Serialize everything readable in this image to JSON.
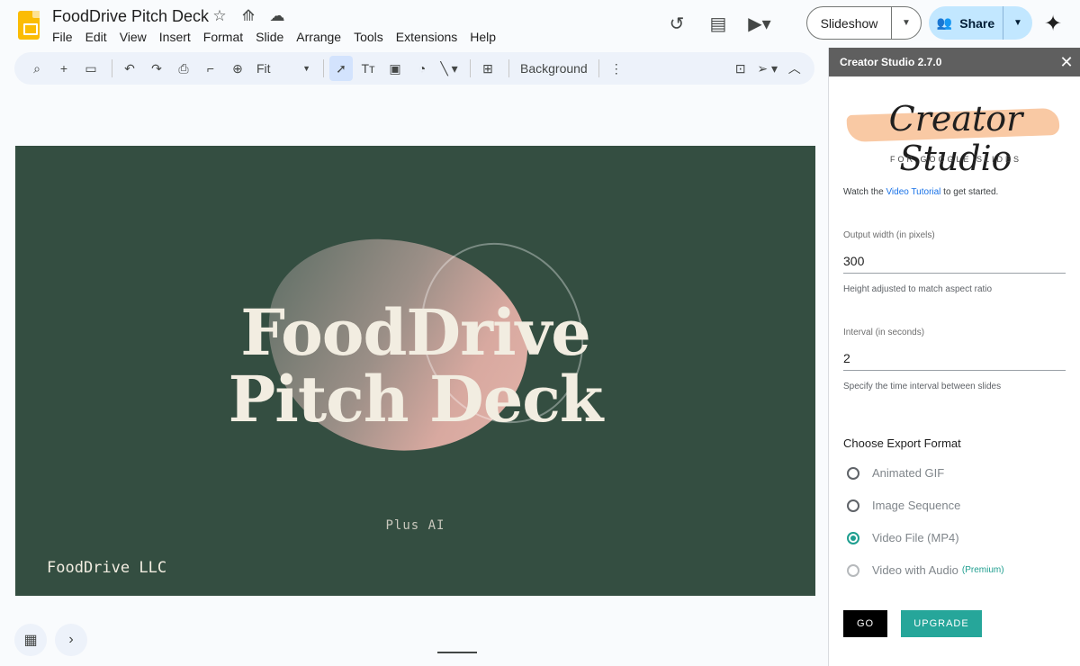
{
  "app": {
    "doc_title": "FoodDrive Pitch Deck",
    "menu": [
      "File",
      "Edit",
      "View",
      "Insert",
      "Format",
      "Slide",
      "Arrange",
      "Tools",
      "Extensions",
      "Help"
    ]
  },
  "header": {
    "slideshow_label": "Slideshow",
    "share_label": "Share"
  },
  "toolbar": {
    "zoom_value": "Fit",
    "background_label": "Background"
  },
  "slide": {
    "title_line1": "FoodDrive",
    "title_line2": "Pitch Deck",
    "subtitle": "Plus AI",
    "company": "FoodDrive LLC",
    "bg_color": "#344e41"
  },
  "panel": {
    "title": "Creator Studio 2.7.0",
    "logo_name": "Creator Studio",
    "logo_for": "FOR GOOGLE SLIDES",
    "intro_prefix": "Watch the ",
    "intro_link": "Video Tutorial",
    "intro_suffix": " to get started.",
    "width_label": "Output width (in pixels)",
    "width_value": "300",
    "width_hint": "Height adjusted to match aspect ratio",
    "interval_label": "Interval (in seconds)",
    "interval_value": "2",
    "interval_hint": "Specify the time interval between slides",
    "format_heading": "Choose Export Format",
    "formats": [
      {
        "label": "Animated GIF",
        "checked": false
      },
      {
        "label": "Image Sequence",
        "checked": false
      },
      {
        "label": "Video File (MP4)",
        "checked": true
      },
      {
        "label": "Video with Audio",
        "checked": false,
        "tag": "(Premium)"
      }
    ],
    "go_label": "GO",
    "upgrade_label": "UPGRADE",
    "accent_color": "#26a69a"
  }
}
